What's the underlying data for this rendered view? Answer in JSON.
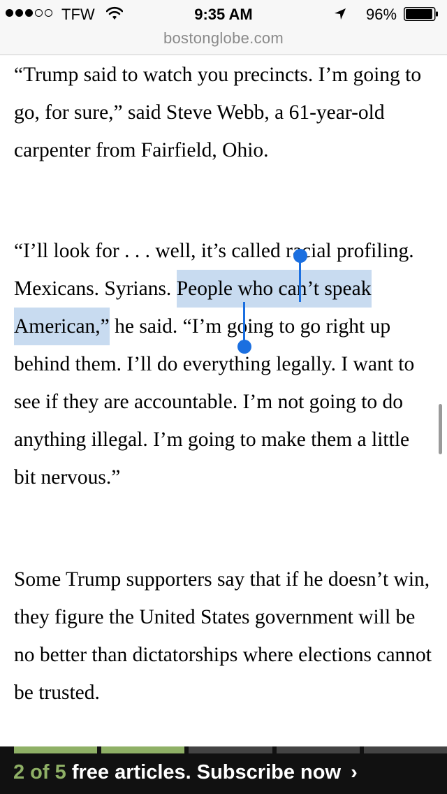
{
  "status_bar": {
    "carrier": "TFW",
    "time": "9:35 AM",
    "battery_percent": "96%",
    "signal_bars": 3,
    "signal_total": 5,
    "battery_level": 0.96,
    "icons": [
      "wifi-icon",
      "location-arrow-icon",
      "battery-icon"
    ]
  },
  "url_bar": {
    "domain": "bostonglobe.com"
  },
  "article": {
    "paragraph1": "“Trump said to watch you precincts. I’m going to go, for sure,” said Steve Webb, a 61-year-old carpenter from Fairfield, Ohio.",
    "paragraph2_before": "“I’ll look for . . . well, it’s called racial profiling. Mexicans. Syrians. ",
    "paragraph2_selected": "People who can’t speak American,”",
    "paragraph2_after": " he said. “I’m going to go right up behind them. I’ll do everything legally. I want to see if they are accountable. I’m not going to do anything illegal. I’m going to make them a little bit nervous.”",
    "paragraph3": "Some Trump supporters say that if he doesn’t win, they figure the United States government will be no better than dictatorships where elections cannot be trusted."
  },
  "subscribe": {
    "count_text": "2 of 5",
    "message": "free articles. Subscribe now",
    "chevron": "›",
    "articles_read": 2,
    "articles_total": 5,
    "read_color": "#8fb066",
    "unread_color": "#444444"
  },
  "colors": {
    "selection": "#aac8e8",
    "handle": "#1b6fe0"
  }
}
